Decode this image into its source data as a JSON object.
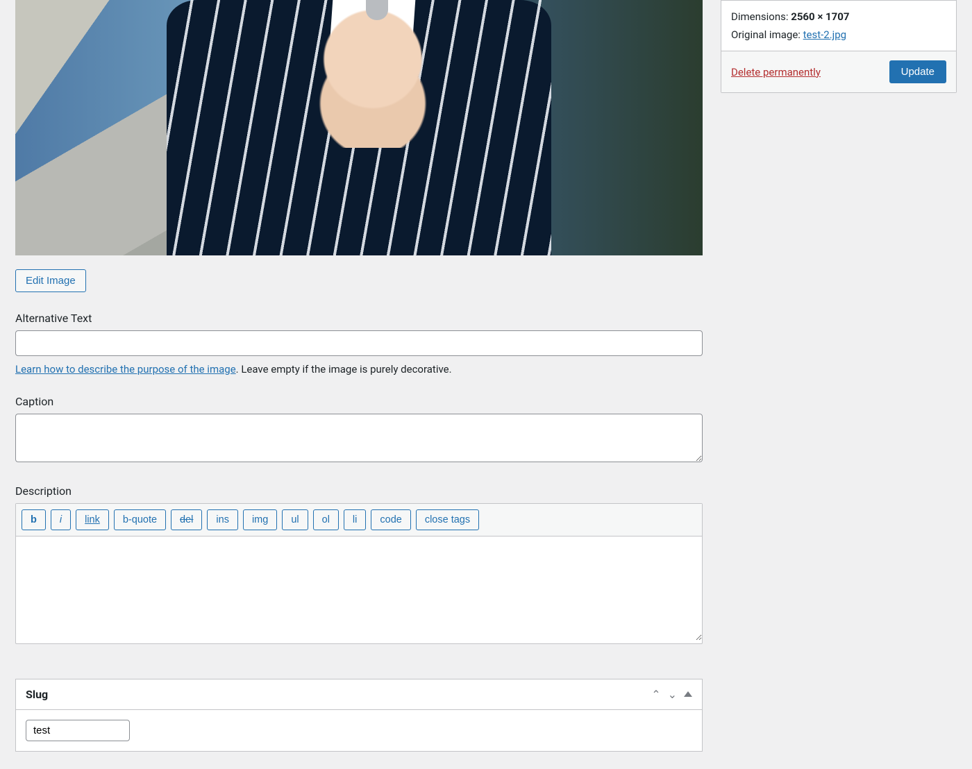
{
  "main": {
    "edit_image_label": "Edit Image",
    "alt_text": {
      "label": "Alternative Text",
      "value": "",
      "help_link": "Learn how to describe the purpose of the image",
      "help_suffix": ". Leave empty if the image is purely decorative."
    },
    "caption": {
      "label": "Caption",
      "value": ""
    },
    "description": {
      "label": "Description",
      "value": "",
      "toolbar": [
        "b",
        "i",
        "link",
        "b-quote",
        "del",
        "ins",
        "img",
        "ul",
        "ol",
        "li",
        "code",
        "close tags"
      ]
    },
    "slug": {
      "title": "Slug",
      "value": "test"
    }
  },
  "sidebar": {
    "dimensions_label": "Dimensions: ",
    "dimensions_value": "2560 × 1707",
    "original_label": "Original image: ",
    "original_filename": "test-2.jpg",
    "delete_label": "Delete permanently",
    "update_label": "Update"
  }
}
